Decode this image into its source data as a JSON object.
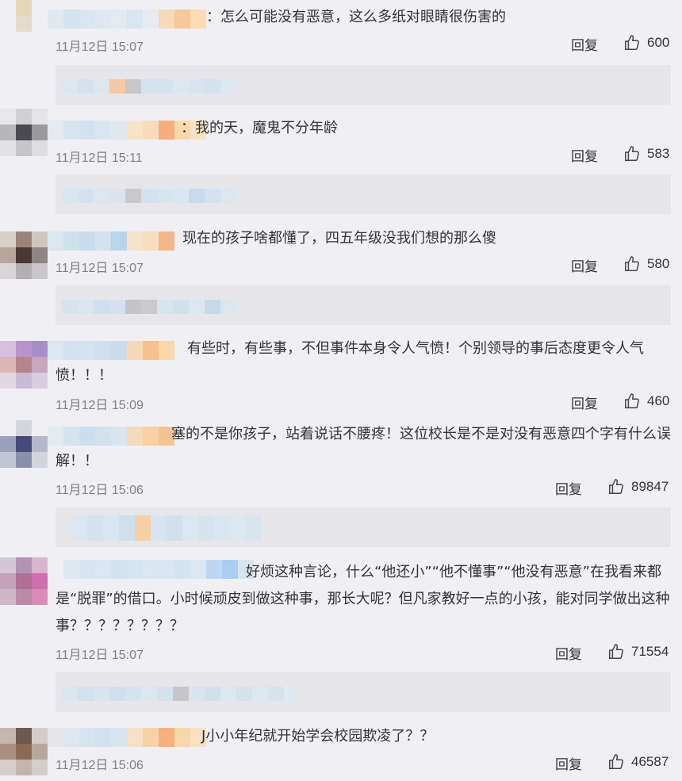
{
  "reply_label": "回复",
  "comments": [
    {
      "text_lines": [
        "：怎么可能没有恶意，这么多纸对眼睛很伤害的"
      ],
      "time": "11月12日 15:07",
      "likes": "600"
    },
    {
      "text_lines": [
        "：我的天，魔鬼不分年龄"
      ],
      "time": "11月12日 15:11",
      "likes": "583"
    },
    {
      "text_lines": [
        "现在的孩子啥都懂了，四五年级没我们想的那么傻"
      ],
      "time": "11月12日 15:07",
      "likes": "580"
    },
    {
      "text_lines": [
        "有些时，有些事，不但事件本身令人气愤！个别领导的事后态度更令人气",
        "愤！！！"
      ],
      "time": "11月12日 15:09",
      "likes": "460"
    },
    {
      "text_lines": [
        "塞的不是你孩子，站着说话不腰疼！这位校长是不是对没有恶意四个字有什么误",
        "解！！"
      ],
      "time": "11月12日 15:06",
      "likes": "89847"
    },
    {
      "text_lines": [
        "好烦这种言论，什么“他还小”“他不懂事”“他没有恶意”在我看来都",
        "是“脱罪”的借口。小时候顽皮到做这种事，那长大呢？但凡家教好一点的小孩，能对同学做出这种",
        "事？？？？？？？？"
      ],
      "time": "11月12日 15:07",
      "likes": "71554"
    },
    {
      "text_lines": [
        "J小小年纪就开始学会校园欺凌了？？"
      ],
      "time": "11月12日 15:06",
      "likes": "46587"
    }
  ],
  "colors": {
    "background": "#f0f0f4",
    "reply_box": "#e6e6ea",
    "time": "#808080",
    "text": "#333333"
  }
}
